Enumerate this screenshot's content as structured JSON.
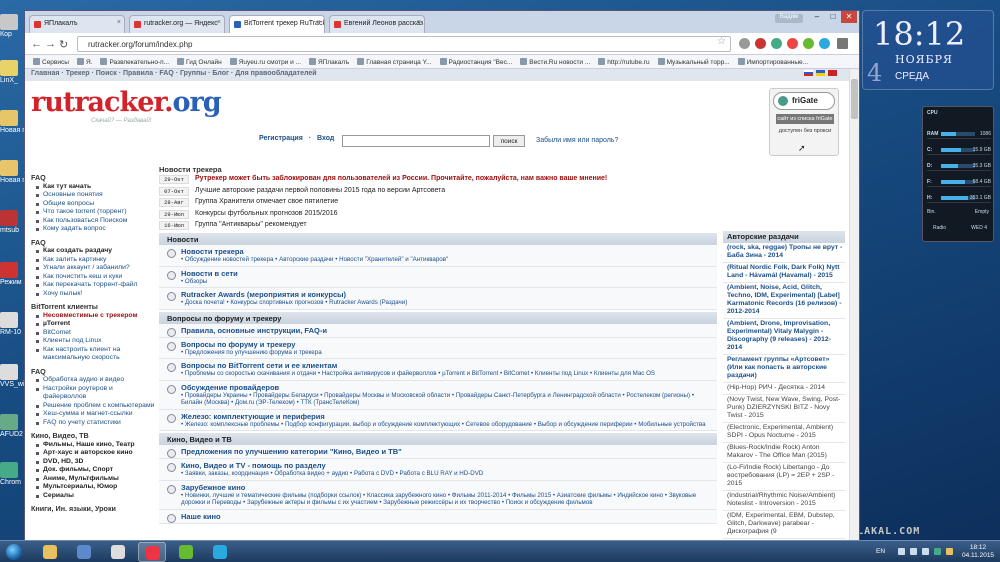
{
  "desktop": {
    "icons": [
      {
        "label": "Кор",
        "color": "#c8c8c8"
      },
      {
        "label": "LinX_",
        "color": "#e7d36a"
      },
      {
        "label": "Новая п",
        "color": "#e7c66a"
      },
      {
        "label": "Новая п",
        "color": "#e7c66a"
      },
      {
        "label": "mtsub",
        "color": "#b33"
      },
      {
        "label": "Режим проблем",
        "color": "#c33"
      },
      {
        "label": "RM-10",
        "color": "#ddd"
      },
      {
        "label": "VVS_wi",
        "color": "#ddd"
      },
      {
        "label": "AFUD2",
        "color": "#6a8"
      },
      {
        "label": "Chrom",
        "color": "#4a8"
      }
    ]
  },
  "clock_gadget": {
    "time": "18:12",
    "month": "НОЯБРЯ",
    "weekday": "СРЕДА",
    "day": "4"
  },
  "meter_gadget": {
    "title": "CPU",
    "rows": [
      {
        "label": "RAM",
        "value": "1086",
        "level": 0.45
      },
      {
        "label": "C:",
        "value": "15.9 GB",
        "level": 0.6
      },
      {
        "label": "D:",
        "value": "35.3 GB",
        "level": 0.5
      },
      {
        "label": "F:",
        "value": "68.4 GB",
        "level": 0.7
      },
      {
        "label": "H:",
        "value": "353.1 GB",
        "level": 0.8
      }
    ],
    "footer_left": "Bin.",
    "footer_right": "Empty",
    "radio": "Radio",
    "wed": "WED 4"
  },
  "browser": {
    "user_button": "Вадим",
    "tabs": [
      {
        "label": "ЯПлакалъ",
        "color": "#d33",
        "active": false
      },
      {
        "label": "rutracker.org — Яндекс",
        "color": "#d33",
        "active": false
      },
      {
        "label": "BitTorrent трекер RuTrack",
        "color": "#2a60b6",
        "active": true
      },
      {
        "label": "Евгений Леонов рассказ",
        "color": "#d33",
        "active": false
      }
    ],
    "url": "rutracker.org/forum/index.php",
    "bookmarks": [
      "Сервисы",
      "Я.",
      "Развлекательно-п...",
      "Гид Онлайн",
      "Яuyeu.ru смотри и ...",
      "ЯПлакалъ",
      "Главная страница Y...",
      "Радиостанция \"Вес...",
      "Вести.Ru новости ...",
      "http://rutube.ru",
      "Музыкальный торр...",
      "Импортированные..."
    ]
  },
  "site": {
    "topnav": "Главная · Трекер · Поиск · Правила · FAQ · Группы · Блог · Для правообладателей",
    "logo_main": "rutracker",
    "logo_dot": ".",
    "logo_tld": "org",
    "logo_slogan": "Скачай? — Раздавай!",
    "login": {
      "register": "Регистрация",
      "sep": "·",
      "enter": "Вход",
      "search_btn": "поиск",
      "forgot": "Забыли имя или пароль?"
    },
    "frigate": {
      "title": "friGate",
      "btn": "сайт из списка friGate",
      "status": "доступен без прокси"
    },
    "left": [
      {
        "type": "sec",
        "text": "FAQ"
      },
      {
        "type": "bold",
        "text": "Как тут качать"
      },
      {
        "type": "item",
        "text": "Основные понятия"
      },
      {
        "type": "item",
        "text": "Общие вопросы"
      },
      {
        "type": "item",
        "text": "Что такое torrent (торрент)"
      },
      {
        "type": "item",
        "text": "Как пользоваться Поиском"
      },
      {
        "type": "item",
        "text": "Кому задать вопрос"
      },
      {
        "type": "sec",
        "text": "FAQ"
      },
      {
        "type": "bold",
        "text": "Как создать раздачу"
      },
      {
        "type": "item",
        "text": "Как залить картинку"
      },
      {
        "type": "item",
        "text": "Угнали аккаунт / забанили?"
      },
      {
        "type": "item",
        "text": "Как почистить кеш и куки"
      },
      {
        "type": "item",
        "text": "Как перекачать торрент-файл"
      },
      {
        "type": "item",
        "text": "Хочу пылык!"
      },
      {
        "type": "sec",
        "text": "BitTorrent клиенты"
      },
      {
        "type": "red",
        "text": "Несовместимые с трекером"
      },
      {
        "type": "bold",
        "text": "µTorrent"
      },
      {
        "type": "item",
        "text": "BitComet"
      },
      {
        "type": "item",
        "text": "Клиенты под Linux"
      },
      {
        "type": "wrap",
        "text": "Как настроить клиент на максимальную скорость"
      },
      {
        "type": "sec",
        "text": "FAQ"
      },
      {
        "type": "item",
        "text": "Обработка аудио и видео"
      },
      {
        "type": "wrap",
        "text": "Настройки роутеров и файерволлов"
      },
      {
        "type": "item",
        "text": "Решение проблем с компьютерами"
      },
      {
        "type": "item",
        "text": "Хеш-сумма и магнет-ссылки"
      },
      {
        "type": "item",
        "text": "FAQ по учету статистики"
      },
      {
        "type": "sec",
        "text": "Кино, Видео, ТВ"
      },
      {
        "type": "bold",
        "text": "Фильмы, Наше кино, Театр"
      },
      {
        "type": "bold",
        "text": "Арт-хаус и авторское кино"
      },
      {
        "type": "bold",
        "text": "DVD, HD, 3D"
      },
      {
        "type": "bold",
        "text": "Док. фильмы, Спорт"
      },
      {
        "type": "bold",
        "text": "Аниме, Мультфильмы"
      },
      {
        "type": "bold",
        "text": "Мультсериалы, Юмор"
      },
      {
        "type": "bold",
        "text": "Сериалы"
      },
      {
        "type": "sec",
        "text": "Книги, Ин. языки, Уроки"
      }
    ],
    "news": {
      "title": "Новости трекера",
      "items": [
        {
          "date": "29-Окт",
          "text": "Рутрекер может быть заблокирован для пользователей из России. Прочитайте, пожалуйста, нам важно ваше мнение!",
          "red": true
        },
        {
          "date": "07-Окт",
          "text": "Лучшие авторские раздачи первой половины 2015 года по версии Артсовета",
          "red": false
        },
        {
          "date": "28-Авг",
          "text": "Группа Хранители отмечает свое пятилетие",
          "red": false
        },
        {
          "date": "29-Июл",
          "text": "Конкурсы футбольных прогнозов 2015/2016",
          "red": false
        },
        {
          "date": "16-Июл",
          "text": "Группа \"Антикварьы\" рекомендует",
          "red": false
        }
      ]
    },
    "forums": [
      {
        "cat": "Новости",
        "rows": [
          {
            "title": "Новости трекера",
            "subs": "• Обсуждение новостей трекера • Авторские раздачи • Новости \"Хранителей\" и \"Антикваров\""
          },
          {
            "title": "Новости в сети",
            "subs": "• Обзоры"
          },
          {
            "title": "Rutracker Awards (мероприятия и конкурсы)",
            "subs": "• Доска почета! • Конкурсы спортивных прогнозов • Rutracker Awards (Раздачи)"
          }
        ]
      },
      {
        "cat": "Вопросы по форуму и трекеру",
        "rows": [
          {
            "title": "Правила, основные инструкции, FAQ-и",
            "subs": ""
          },
          {
            "title": "Вопросы по форуму и трекеру",
            "subs": "• Предложения по улучшению форума и трекера"
          },
          {
            "title": "Вопросы по BitTorrent сети и ее клиентам",
            "subs": "• Проблемы со скоростью скачивания и отдачи • Настройка антивирусов и файерволлов • µTorrent и BitTorrent • BitComet • Клиенты под Linux • Клиенты для Mac OS"
          },
          {
            "title": "Обсуждение провайдеров",
            "subs": "• Провайдеры Украины • Провайдеры Беларуси • Провайдеры Москвы и Московской области • Провайдеры Санкт-Петербурга и Ленинградской области • Ростелеком (регионы) • Билайн (Москва) • Дом.ru (ЭР-Телеком) • ТТК (ТрансТелеКом)"
          },
          {
            "title": "Железо: комплектующие и периферия",
            "subs": "• Железо: комплексные проблемы • Подбор конфигурации, выбор и обсуждение комплектующих • Сетевое оборудование • Выбор и обсуждение периферии • Мобильные устройства"
          }
        ]
      },
      {
        "cat": "Кино, Видео и ТВ",
        "rows": [
          {
            "title": "Предложения по улучшению категории \"Кино, Видео и ТВ\"",
            "subs": ""
          },
          {
            "title": "Кино, Видео и ТV - помощь по разделу",
            "subs": "• Заявки, заказы, координация • Обработка видео + аудио • Работа с DVD • Работа с BLU RAY и HD-DVD"
          },
          {
            "title": "Зарубежное кино",
            "subs": "• Новинки, лучшие и тематические фильмы (подборки ссылок) • Классика зарубежного кино • Фильмы 2011-2014 • Фильмы 2015 • Азиатские фильмы • Индийское кино • Звуковые дорожки и Переводы • Зарубежные актеры и фильмы с их участием • Зарубежные режиссёры и их творчество • Поиск и обсуждение фильмов"
          },
          {
            "title": "Наше кино",
            "subs": ""
          }
        ]
      }
    ],
    "right": {
      "title": "Авторские раздачи",
      "items": [
        {
          "text": "(rock, ska, reggae) Тропы не врут - Баба Зина - 2014",
          "bold": true
        },
        {
          "text": "(Ritual Nordic Folk, Dark Folk) Nytt Land - Hávamál (Havamal) - 2015",
          "bold": true
        },
        {
          "text": "(Ambient, Noise, Acid, Glitch, Techno, IDM, Experimental) [Label] Karmatonic Records (16 релизов) - 2012-2014",
          "bold": true
        },
        {
          "text": "(Ambient, Drone, Improvisation, Experimental) Vitaly Malygin - Discography (9 releases) - 2012-2014",
          "bold": true
        },
        {
          "text": "Регламент группы «Артсовет» (Или как попасть в авторские раздачи)",
          "bold": true
        },
        {
          "text": "(Hip-Hop) РИЧ - Десятка - 2014",
          "bold": false
        },
        {
          "text": "(Novy Twist, New Wave, Swing, Post-Punk) DZIERZYNSKI BITZ - Novy Twist - 2015",
          "bold": false
        },
        {
          "text": "(Electronic, Experimental, Ambient) SDPI - Opus Nocturne - 2015",
          "bold": false
        },
        {
          "text": "(Blues-Rock/Indie Rock) Anton Makarov - The Office Man (2015)",
          "bold": false
        },
        {
          "text": "(Lo-Fi/Indie Rock) Libertango - До востребования (LP) = 2EP + 2SP - 2015",
          "bold": false
        },
        {
          "text": "(Industrial/Rhythmic Noise/Ambient) Noteslist - Introversion - 2015",
          "bold": false
        },
        {
          "text": "(IDM, Experimental, EBM, Dubstep, Glitch, Darkwave) parabear - Дискография (9",
          "bold": false
        }
      ]
    }
  },
  "taskbar": {
    "apps": [
      {
        "name": "explorer",
        "color": "#e8c060"
      },
      {
        "name": "media",
        "color": "#5a8acb"
      },
      {
        "name": "tool",
        "color": "#ddd"
      },
      {
        "name": "chrome",
        "color": "#e34"
      },
      {
        "name": "utorrent",
        "color": "#6b3"
      },
      {
        "name": "skype",
        "color": "#2aa9e0"
      }
    ],
    "lang": "EN",
    "time": "18:12",
    "date": "04.11.2015"
  },
  "watermark": "YAPLAKAL.COM"
}
